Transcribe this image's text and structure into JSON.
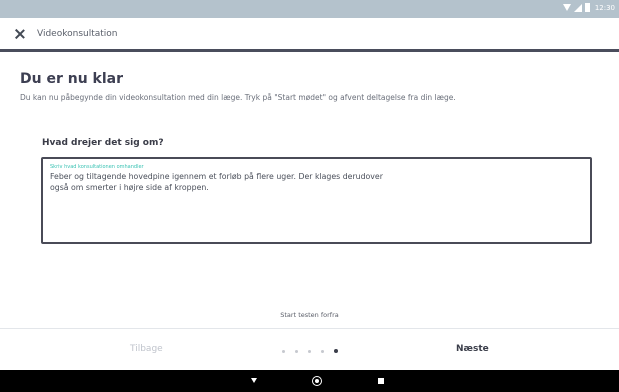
{
  "status_bar": {
    "time": "12:30",
    "icons": [
      "wifi-icon",
      "signal-icon",
      "battery-icon"
    ]
  },
  "app_bar": {
    "close_icon": "close-icon",
    "title": "Videokonsultation"
  },
  "main": {
    "heading": "Du er nu klar",
    "subtext": "Du kan nu påbegynde din videokonsultation med din læge. Tryk på \"Start mødet\" og afvent deltagelse fra din læge.",
    "question_label": "Hvad drejer det sig om?",
    "textbox": {
      "label": "Skriv hvad konsultationen omhandler",
      "value": "Feber og tiltagende hovedpine igennem et forløb på flere uger. Der klages derudover\nogså om smerter i højre side af kroppen."
    },
    "start_test": "Start testen forfra"
  },
  "bottom_nav": {
    "back_label": "Tilbage",
    "next_label": "Næste",
    "pager": {
      "total": 5,
      "active": 5
    }
  },
  "system_nav": {
    "icons": [
      "back-icon",
      "home-icon",
      "recents-icon"
    ]
  },
  "colors": {
    "accent_teal": "#39c2b3",
    "appbar_border": "#4a4d5c",
    "statusbar": "#b4c2cc"
  }
}
